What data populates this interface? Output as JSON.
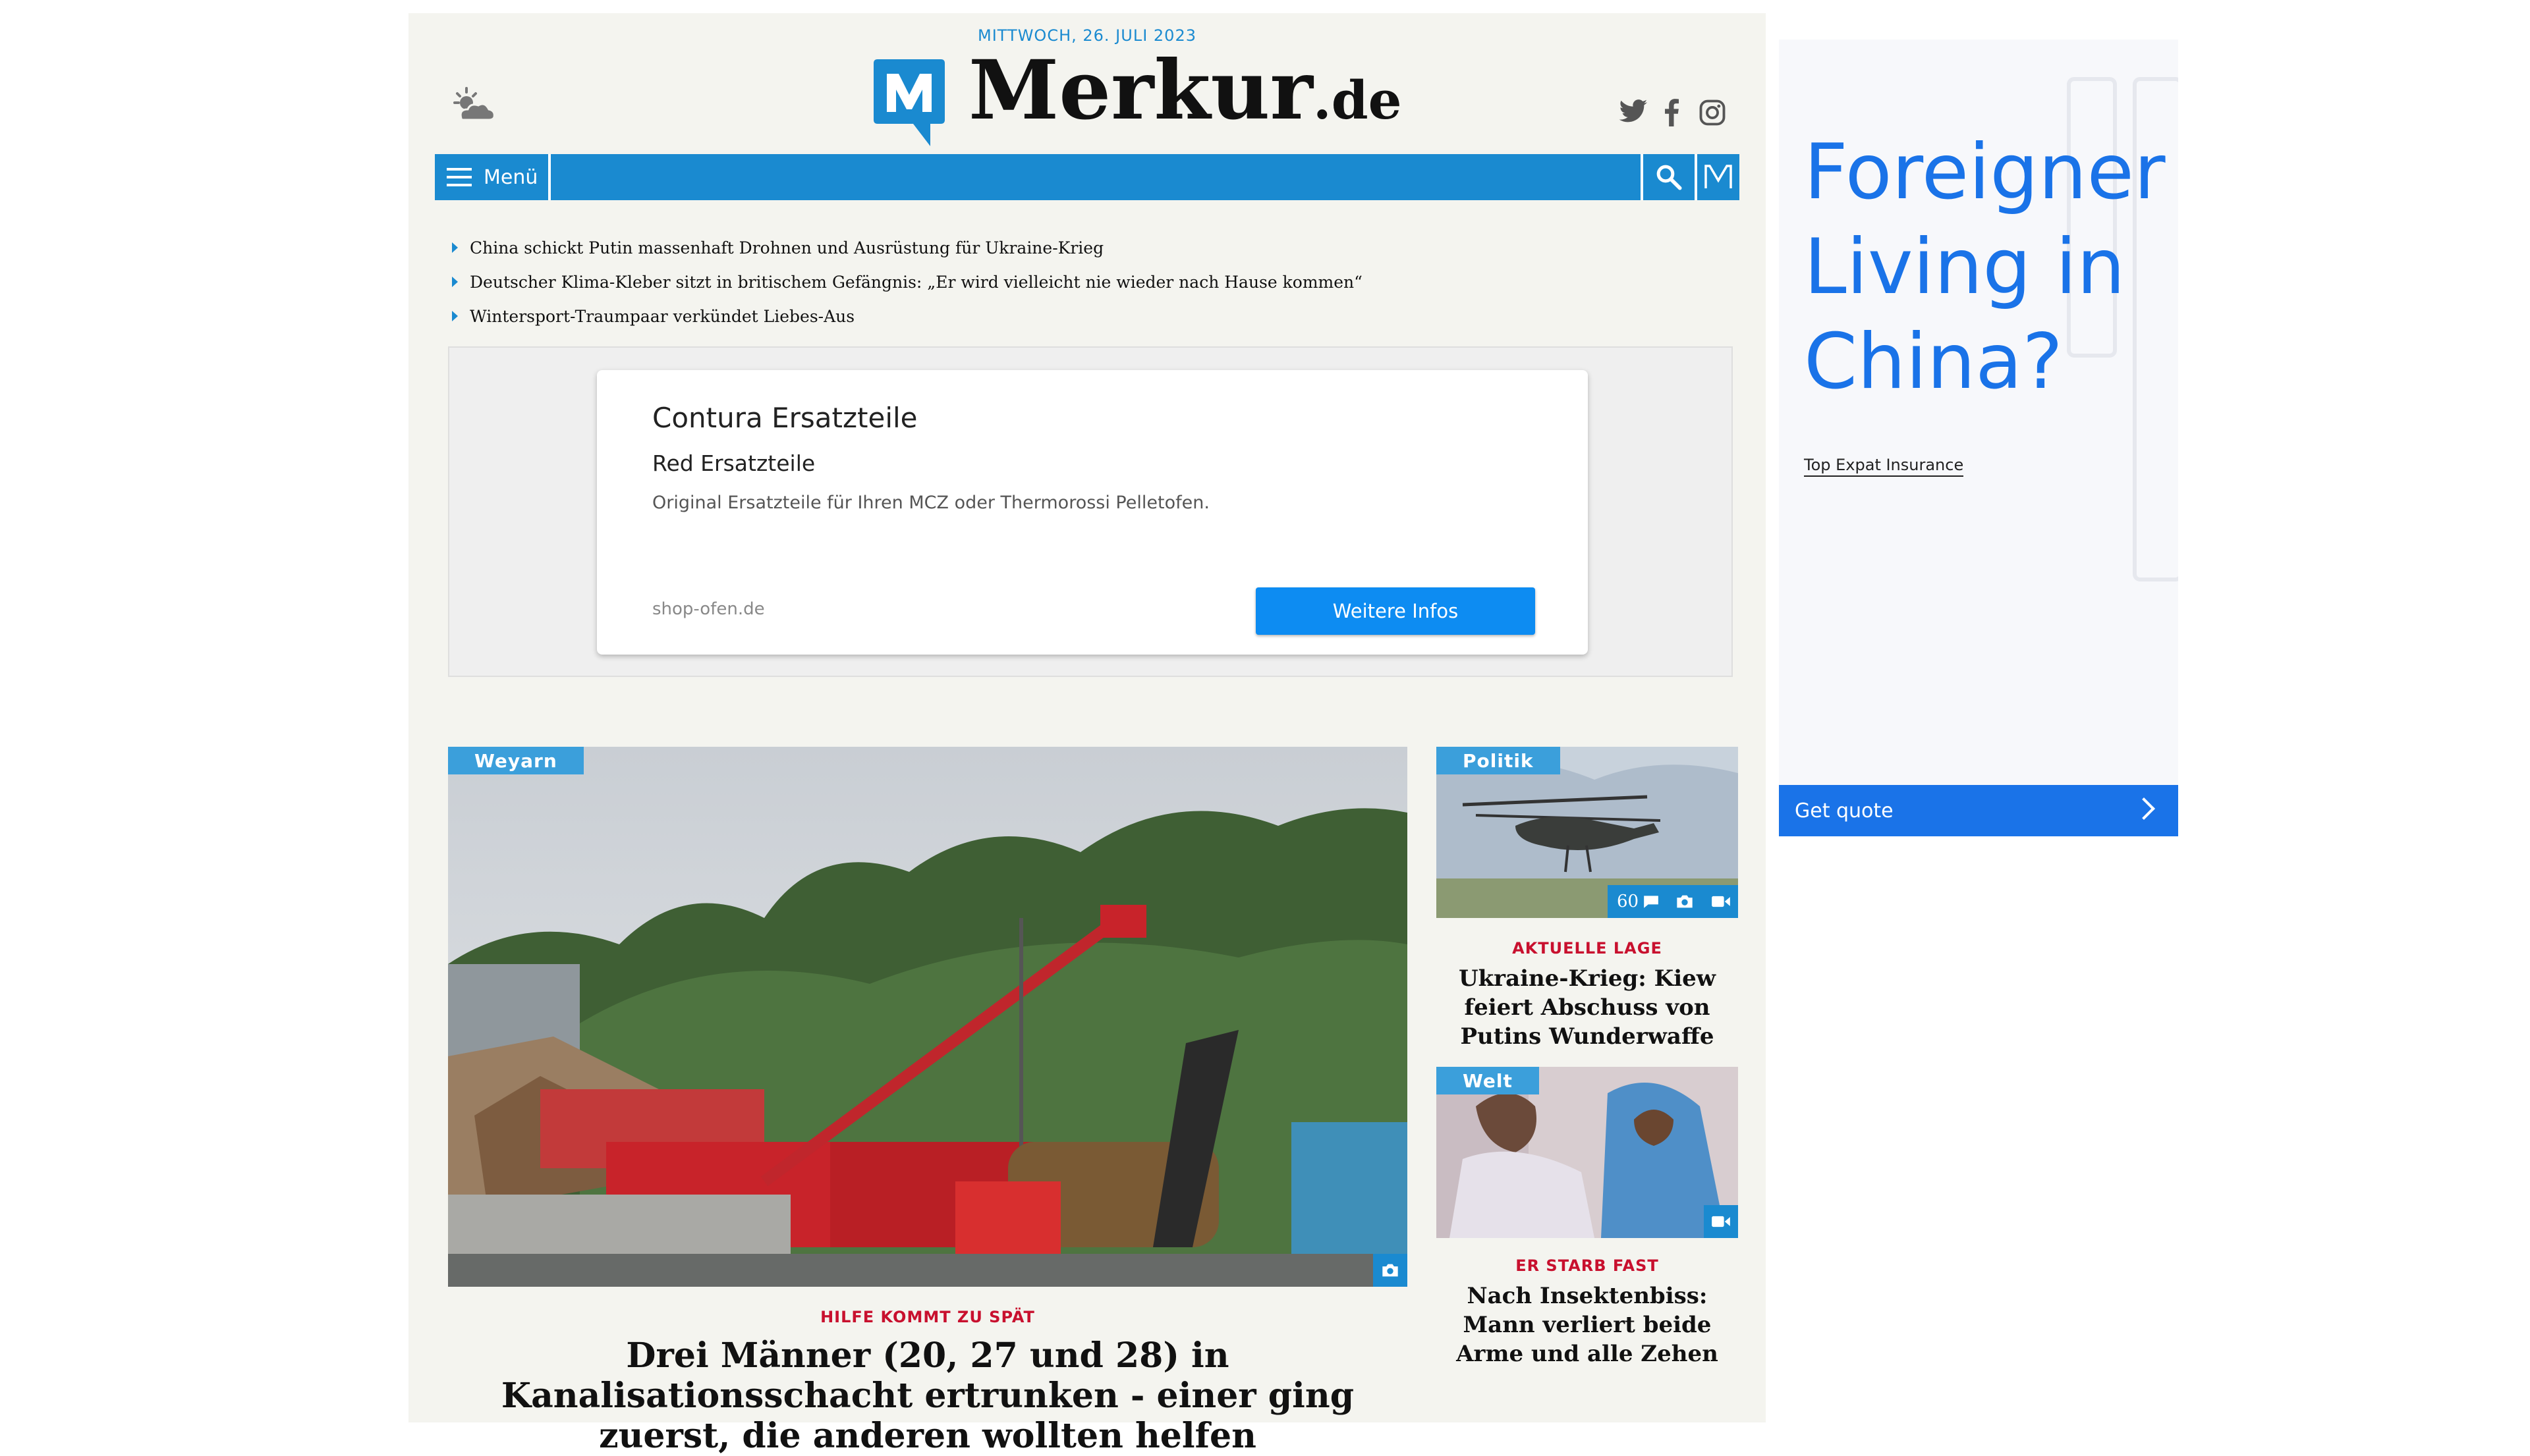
{
  "header": {
    "date": "MITTWOCH, 26. JULI 2023",
    "logo_text": "Merkur",
    "logo_suffix": ".de"
  },
  "nav": {
    "menu_label": "Menü"
  },
  "headlines": [
    "China schickt Putin massenhaft Drohnen und Ausrüstung für Ukraine-Krieg",
    "Deutscher Klima-Kleber sitzt in britischem Gefängnis: „Er wird vielleicht nie wieder nach Hause kommen“",
    "Wintersport-Traumpaar verkündet Liebes-Aus"
  ],
  "ad": {
    "title": "Contura Ersatzteile",
    "subtitle": "Red Ersatzteile",
    "description": "Original Ersatzteile für Ihren MCZ oder Thermorossi Pelletofen.",
    "domain": "shop-ofen.de",
    "button": "Weitere Infos"
  },
  "main_article": {
    "category": "Weyarn",
    "kicker": "HILFE KOMMT ZU SPÄT",
    "title": "Drei Männer (20, 27 und 28) in Kanalisationsschacht ertrunken - einer ging zuerst, die anderen wollten helfen"
  },
  "side_articles": [
    {
      "category": "Politik",
      "comment_count": "60",
      "kicker": "AKTUELLE LAGE",
      "title": "Ukraine-Krieg: Kiew feiert Abschuss von Putins Wunderwaffe"
    },
    {
      "category": "Welt",
      "kicker": "ER STARB FAST",
      "title": "Nach Insektenbiss: Mann verliert beide Arme und alle Zehen"
    }
  ],
  "right_ad": {
    "headline": "Foreigner Living in China?",
    "link": "Top Expat Insurance",
    "button": "Get quote"
  },
  "colors": {
    "brand_blue": "#1a8ad0",
    "kicker_red": "#c8102e",
    "ad_button_blue": "#0d8cf2",
    "right_ad_blue": "#1a73e8"
  }
}
